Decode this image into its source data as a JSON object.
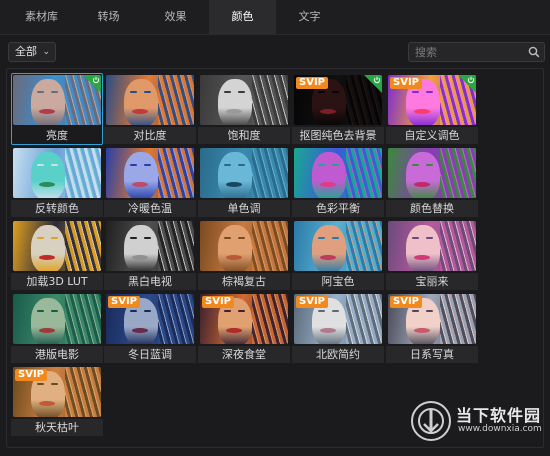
{
  "tabs": [
    {
      "label": "素材库"
    },
    {
      "label": "转场"
    },
    {
      "label": "效果"
    },
    {
      "label": "颜色",
      "active": true
    },
    {
      "label": "文字"
    }
  ],
  "filter": {
    "selected": "全部"
  },
  "search": {
    "placeholder": "搜索"
  },
  "badges": {
    "svip": "SVIP"
  },
  "effects": [
    {
      "label": "亮度",
      "selected": true,
      "corner": true,
      "svip": false,
      "palette": [
        "#6b6a7a",
        "#caa99e",
        "#b33c4a",
        "#3b8fd0"
      ]
    },
    {
      "label": "对比度",
      "corner": false,
      "svip": false,
      "palette": [
        "#2a4c84",
        "#e09a6a",
        "#c33a3a",
        "#e57a33"
      ]
    },
    {
      "label": "饱和度",
      "corner": false,
      "svip": false,
      "palette": [
        "#3a3a3a",
        "#d4d4d4",
        "#9a9a9a",
        "#555555"
      ]
    },
    {
      "label": "抠图纯色去背景",
      "corner": true,
      "svip": true,
      "palette": [
        "#050505",
        "#2b1313",
        "#7a1f28",
        "#101010"
      ]
    },
    {
      "label": "自定义调色",
      "corner": true,
      "svip": true,
      "palette": [
        "#7e2bd1",
        "#ff7adf",
        "#ff3b6a",
        "#f0a23a"
      ]
    },
    {
      "label": "反转颜色",
      "corner": false,
      "svip": false,
      "palette": [
        "#c8e0f0",
        "#5ad1c8",
        "#2e8a5a",
        "#6aa0d8"
      ]
    },
    {
      "label": "冷暖色温",
      "corner": false,
      "svip": false,
      "palette": [
        "#2840a8",
        "#9aa8e8",
        "#c04a6a",
        "#e07a30"
      ]
    },
    {
      "label": "单色调",
      "corner": false,
      "svip": false,
      "palette": [
        "#2a6a8a",
        "#6ab8d8",
        "#1a4860",
        "#3a8ab0"
      ]
    },
    {
      "label": "色彩平衡",
      "corner": false,
      "svip": false,
      "palette": [
        "#1aa890",
        "#c05ad0",
        "#e03a8a",
        "#3a5ad8"
      ]
    },
    {
      "label": "颜色替换",
      "corner": false,
      "svip": false,
      "palette": [
        "#3a8a3a",
        "#c86ad8",
        "#c02a6a",
        "#8a3ab8"
      ]
    },
    {
      "label": "加载3D LUT",
      "corner": false,
      "svip": false,
      "palette": [
        "#e0a020",
        "#d8d0c0",
        "#c02a2a",
        "#2a2a3a"
      ]
    },
    {
      "label": "黑白电视",
      "corner": false,
      "svip": false,
      "palette": [
        "#202020",
        "#d0d0d0",
        "#909090",
        "#505050"
      ]
    },
    {
      "label": "棕褐复古",
      "corner": false,
      "svip": false,
      "palette": [
        "#7a4a20",
        "#e0a070",
        "#b85a3a",
        "#c87a40"
      ]
    },
    {
      "label": "阿宝色",
      "corner": false,
      "svip": false,
      "palette": [
        "#2a7aa8",
        "#e0a080",
        "#c03a5a",
        "#5ab0d0"
      ]
    },
    {
      "label": "宝丽来",
      "corner": false,
      "svip": false,
      "palette": [
        "#6a4a7a",
        "#f0c0c8",
        "#d03a7a",
        "#b85aa0"
      ]
    },
    {
      "label": "港版电影",
      "corner": false,
      "svip": false,
      "palette": [
        "#1a5a4a",
        "#9ab89a",
        "#a03a3a",
        "#3a8a6a"
      ]
    },
    {
      "label": "冬日蓝调",
      "corner": false,
      "svip": true,
      "palette": [
        "#1a2a5a",
        "#9aa8c8",
        "#6a2a4a",
        "#2a4a8a"
      ]
    },
    {
      "label": "深夜食堂",
      "corner": false,
      "svip": true,
      "palette": [
        "#3a2030",
        "#e0a070",
        "#b02a2a",
        "#d06a30"
      ]
    },
    {
      "label": "北欧简约",
      "corner": false,
      "svip": true,
      "palette": [
        "#5a6a7a",
        "#e0e0e0",
        "#b07a8a",
        "#9ab0c8"
      ]
    },
    {
      "label": "日系写真",
      "corner": false,
      "svip": true,
      "palette": [
        "#4a4a5a",
        "#f0d0c8",
        "#c85a6a",
        "#a0a8b8"
      ]
    },
    {
      "label": "秋天枯叶",
      "corner": false,
      "svip": true,
      "palette": [
        "#6a4a20",
        "#e0b080",
        "#c05a3a",
        "#d08040"
      ]
    }
  ],
  "watermark": {
    "name": "当下软件园",
    "url": "www.downxia.com"
  }
}
